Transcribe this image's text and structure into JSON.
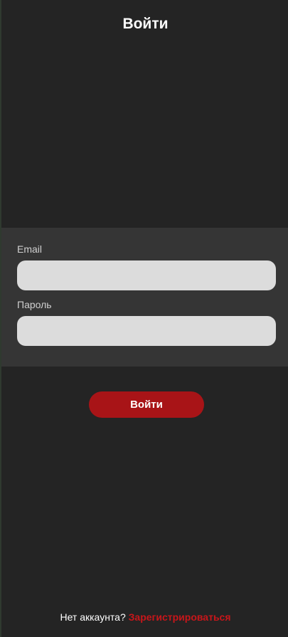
{
  "header": {
    "title": "Войти"
  },
  "form": {
    "email_label": "Email",
    "email_value": "",
    "password_label": "Пароль",
    "password_value": ""
  },
  "actions": {
    "login_label": "Войти"
  },
  "footer": {
    "prompt": "Нет аккаунта?",
    "signup_label": "Зарегистрироваться"
  },
  "colors": {
    "background": "#242424",
    "panel": "#353535",
    "input": "#dcdcdc",
    "accent": "#a81417"
  }
}
